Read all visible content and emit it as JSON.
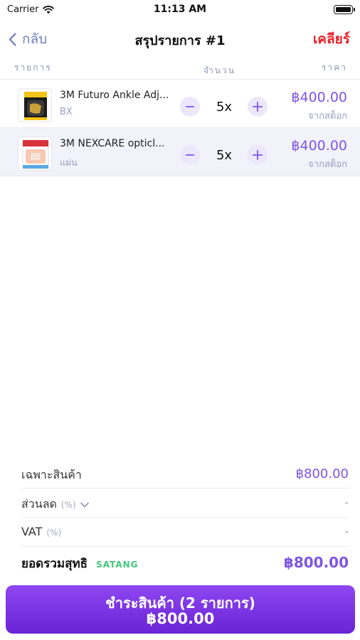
{
  "status_bar": {
    "carrier": "Carrier",
    "time": "11:13 AM"
  },
  "nav": {
    "back_label": "กลับ",
    "title": "สรุปรายการ #1",
    "clear_label": "เคลียร์"
  },
  "columns": {
    "items": "รายการ",
    "quantity": "จำนวน",
    "price": "ราคา"
  },
  "items": [
    {
      "name": "3M Futuro Ankle Adj...",
      "unit": "BX",
      "quantity": "5x",
      "price": "฿400.00",
      "source": "จากสต็อก"
    },
    {
      "name": "3M NEXCARE opticl...",
      "unit": "แผ่น",
      "quantity": "5x",
      "price": "฿400.00",
      "source": "จากสต็อก"
    }
  ],
  "summary": {
    "subtotal_label": "เฉพาะสินค้า",
    "subtotal_value": "฿800.00",
    "discount_label": "ส่วนลด",
    "discount_pct": "(%)",
    "discount_value": "-",
    "vat_label": "VAT",
    "vat_pct": "(%)",
    "vat_value": "-",
    "total_label": "ยอดรวมสุทธิ",
    "total_badge": "SATANG",
    "total_value": "฿800.00"
  },
  "pay_button": {
    "label": "ชำระสินค้า (2 รายการ)",
    "total": "฿800.00"
  },
  "colors": {
    "accent": "#7d55e6",
    "clear": "#e8232a",
    "badge": "#3ec87a",
    "back": "#6e7dbd"
  },
  "icons": {
    "back": "chevron-left-icon",
    "discount_toggle": "chevron-down-icon",
    "wifi": "wifi-icon",
    "battery": "battery-icon"
  }
}
